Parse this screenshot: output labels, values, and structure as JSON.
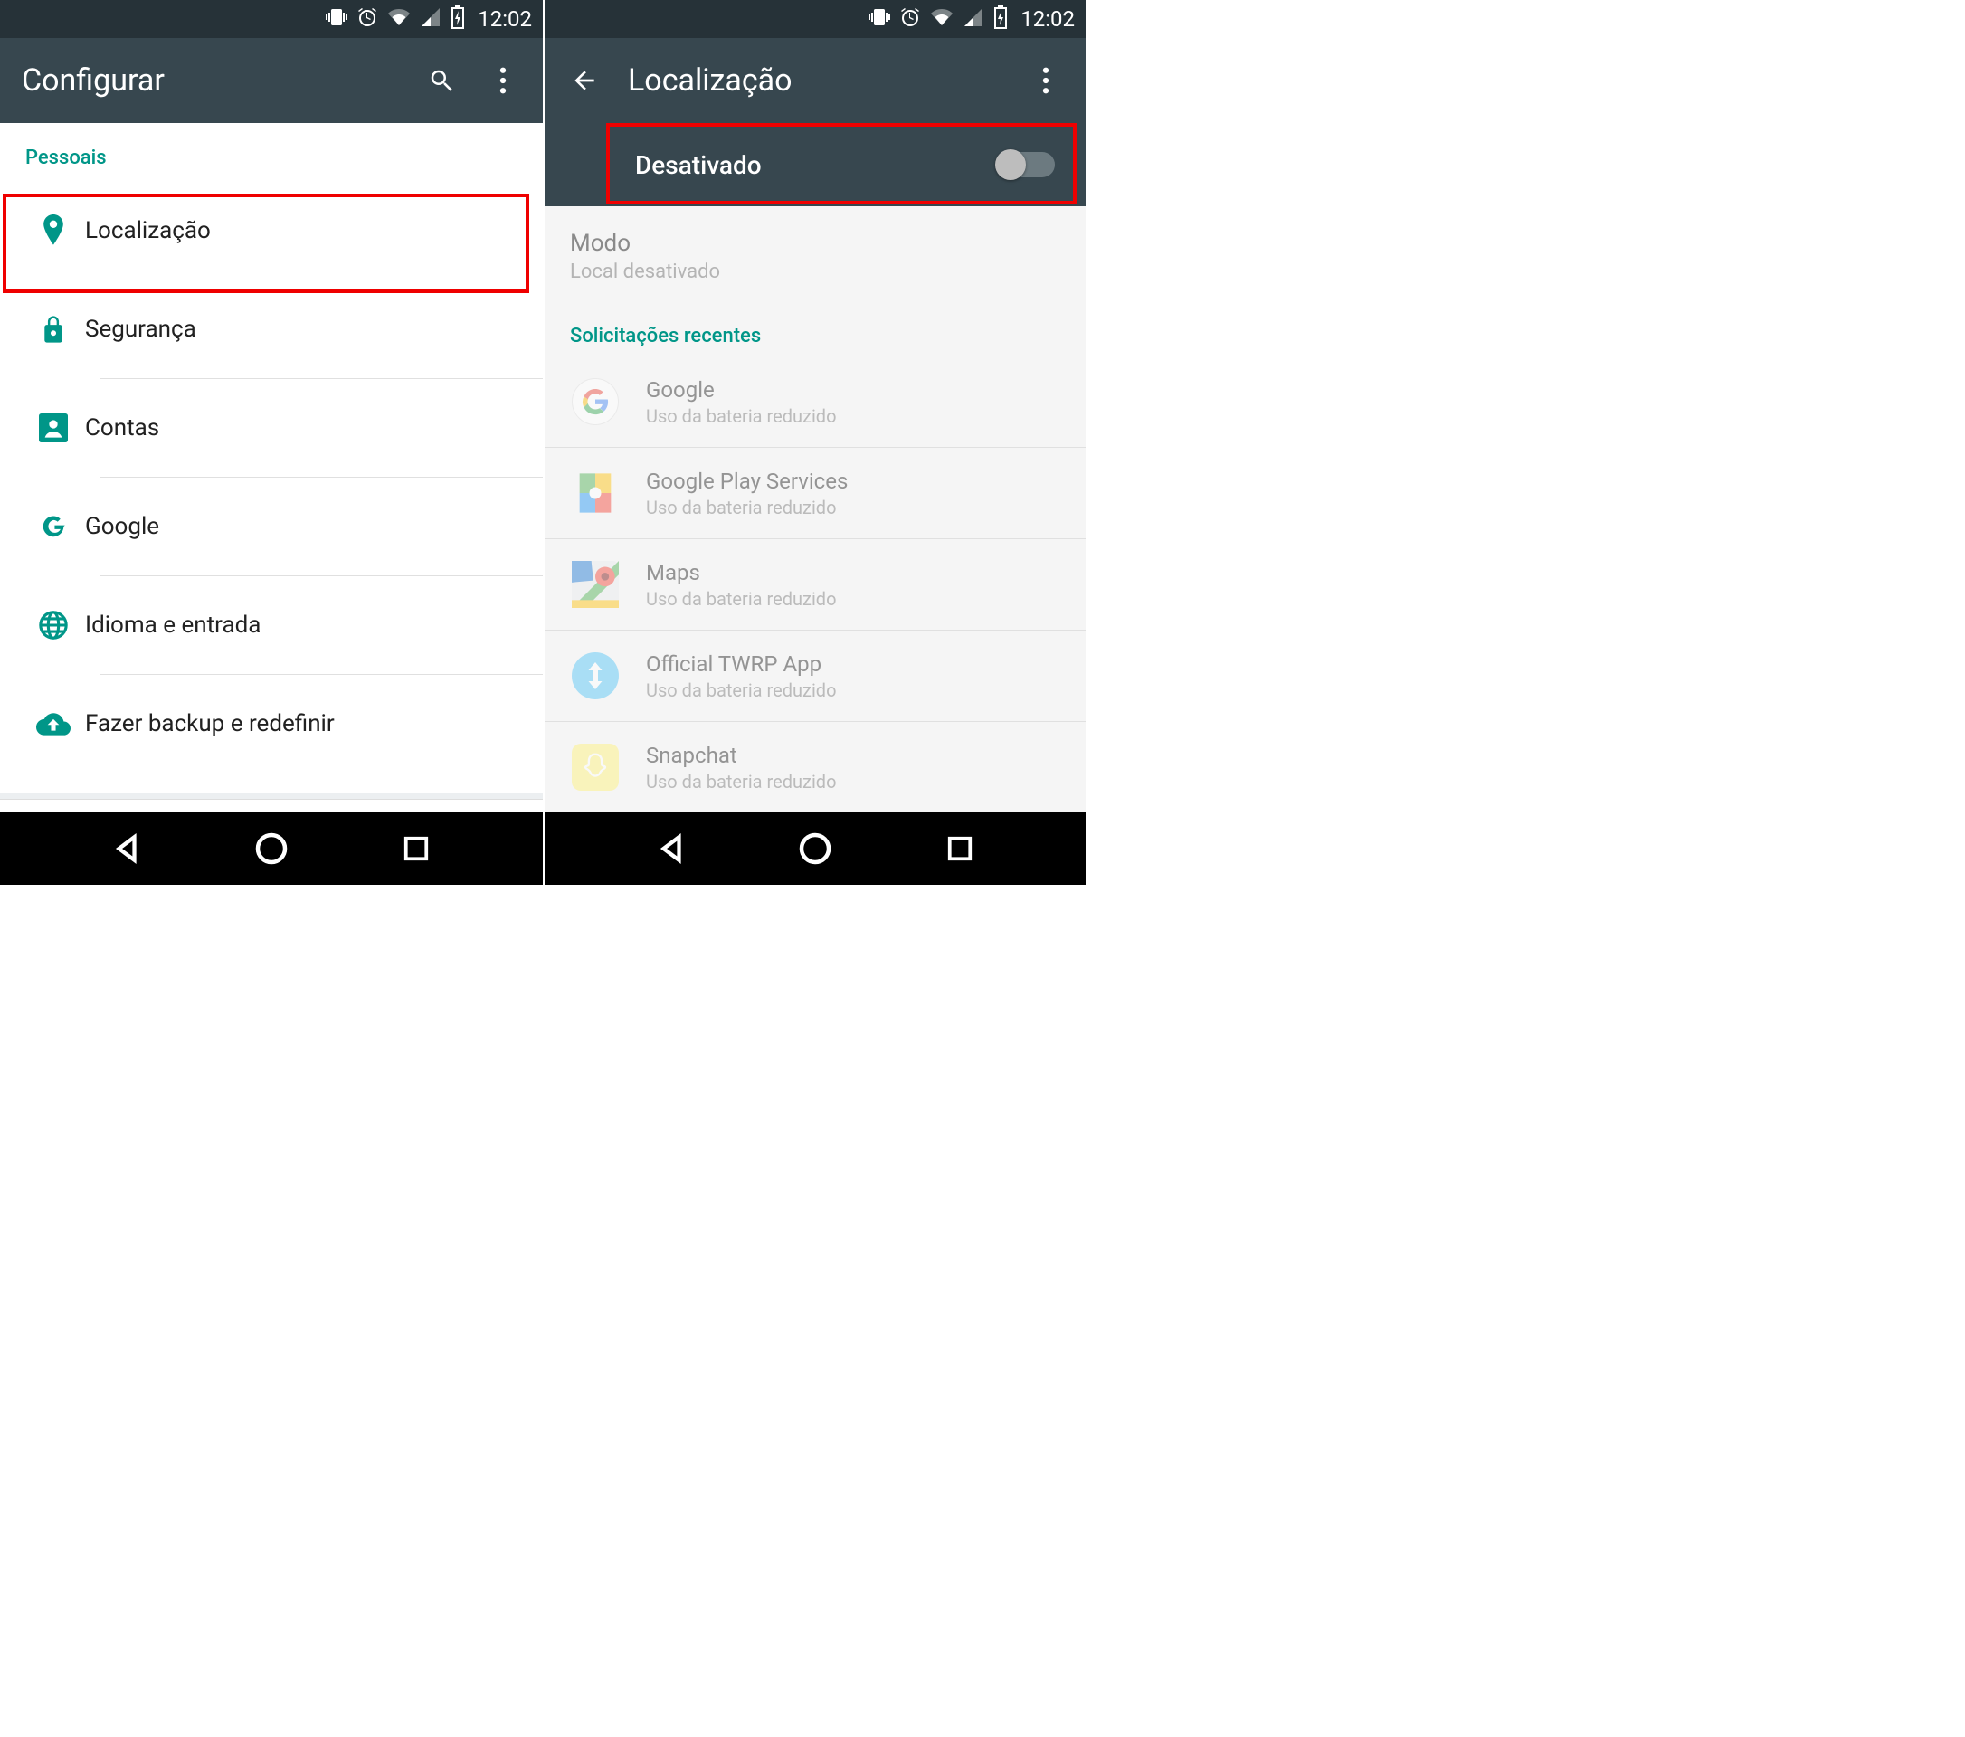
{
  "status": {
    "time": "12:02"
  },
  "left": {
    "title": "Configurar",
    "section": "Pessoais",
    "items": [
      {
        "label": "Localização"
      },
      {
        "label": "Segurança"
      },
      {
        "label": "Contas"
      },
      {
        "label": "Google"
      },
      {
        "label": "Idioma e entrada"
      },
      {
        "label": "Fazer backup e redefinir"
      }
    ]
  },
  "right": {
    "title": "Localização",
    "toggle_label": "Desativado",
    "mode_title": "Modo",
    "mode_sub": "Local desativado",
    "recent_header": "Solicitações recentes",
    "battery_sub": "Uso da bateria reduzido",
    "apps": [
      {
        "name": "Google"
      },
      {
        "name": "Google Play Services"
      },
      {
        "name": "Maps"
      },
      {
        "name": "Official TWRP App"
      },
      {
        "name": "Snapchat"
      }
    ]
  }
}
